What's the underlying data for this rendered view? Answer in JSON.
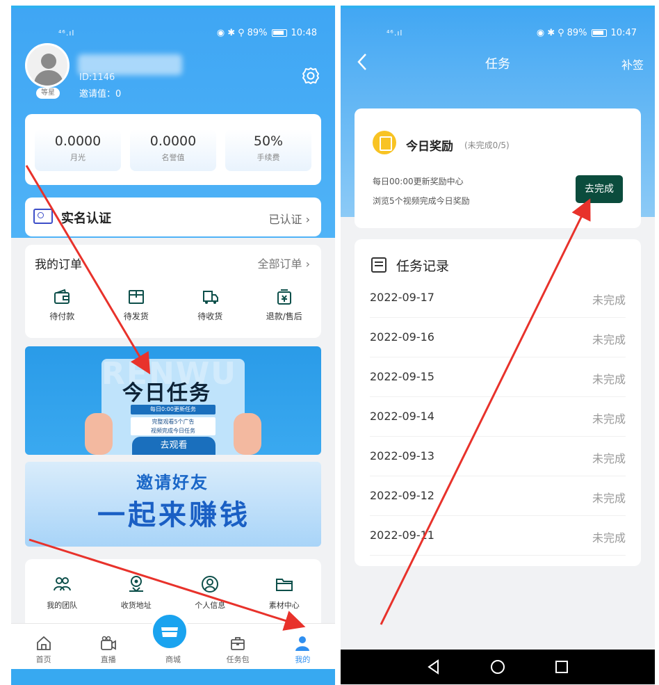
{
  "left": {
    "status": {
      "signal": "⁴⁶.ıl",
      "battery_pct": "89%",
      "time": "10:48"
    },
    "profile": {
      "level": "等星",
      "id_text": "ID:1146",
      "invite_label": "邀请值：",
      "invite_value": "0"
    },
    "stats": [
      {
        "value": "0.0000",
        "label": "月光"
      },
      {
        "value": "0.0000",
        "label": "名誉值"
      },
      {
        "value": "50%",
        "label": "手续费"
      }
    ],
    "verify": {
      "title": "实名认证",
      "status": "已认证"
    },
    "orders": {
      "title": "我的订单",
      "all_label": "全部订单",
      "items": [
        {
          "label": "待付款",
          "icon": "wallet-icon"
        },
        {
          "label": "待发货",
          "icon": "box-icon"
        },
        {
          "label": "待收货",
          "icon": "truck-icon"
        },
        {
          "label": "退款/售后",
          "icon": "refund-icon"
        }
      ]
    },
    "banner_task": {
      "bg_text": "RENWU",
      "headline": "今日任务",
      "sub1": "每日0:00更新任务",
      "sub2a": "完整观看5个广告",
      "sub2b": "视频完成今日任务",
      "button": "去观看"
    },
    "banner_invite": {
      "line1": "邀请好友",
      "line2": "一起来赚钱"
    },
    "tools": [
      {
        "label": "我的团队",
        "icon": "team-icon"
      },
      {
        "label": "收货地址",
        "icon": "location-icon"
      },
      {
        "label": "个人信息",
        "icon": "user-icon"
      },
      {
        "label": "素材中心",
        "icon": "folder-icon"
      }
    ],
    "tabs": [
      {
        "label": "首页",
        "icon": "home-icon"
      },
      {
        "label": "直播",
        "icon": "video-icon"
      },
      {
        "label": "商城",
        "icon": "shop-icon"
      },
      {
        "label": "任务包",
        "icon": "briefcase-icon"
      },
      {
        "label": "我的",
        "icon": "person-icon",
        "active": true
      }
    ]
  },
  "right": {
    "status": {
      "signal": "⁴⁶.ıl",
      "battery_pct": "89%",
      "time": "10:47"
    },
    "header": {
      "title": "任务",
      "sign_label": "补签"
    },
    "reward": {
      "title": "今日奖励",
      "progress": "(未完成0/5)",
      "desc1": "每日00:00更新奖励中心",
      "desc2": "浏览5个视频完成今日奖励",
      "button": "去完成"
    },
    "records": {
      "title": "任务记录",
      "rows": [
        {
          "date": "2022-09-17",
          "status": "未完成"
        },
        {
          "date": "2022-09-16",
          "status": "未完成"
        },
        {
          "date": "2022-09-15",
          "status": "未完成"
        },
        {
          "date": "2022-09-14",
          "status": "未完成"
        },
        {
          "date": "2022-09-13",
          "status": "未完成"
        },
        {
          "date": "2022-09-12",
          "status": "未完成"
        },
        {
          "date": "2022-09-11",
          "status": "未完成"
        }
      ]
    }
  },
  "colors": {
    "brand_blue": "#3fa6f4",
    "dark_green_button": "#0b4c3d",
    "annotation_red": "#e8322b"
  }
}
